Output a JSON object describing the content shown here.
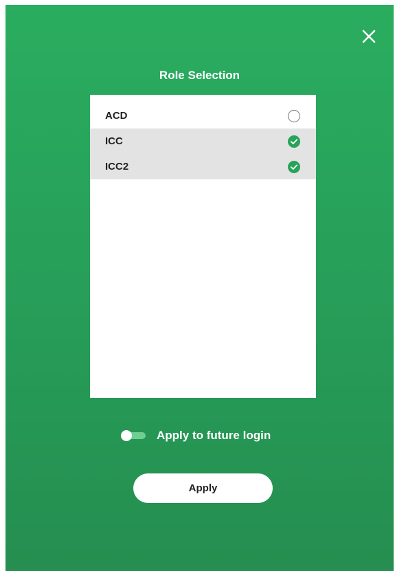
{
  "dialog": {
    "title": "Role Selection",
    "close_icon": "close-icon"
  },
  "roles": [
    {
      "label": "ACD",
      "selected": false,
      "icon": "radio-unchecked-icon"
    },
    {
      "label": "ICC",
      "selected": true,
      "icon": "check-circle-icon"
    },
    {
      "label": "ICC2",
      "selected": true,
      "icon": "check-circle-icon"
    }
  ],
  "future_login": {
    "label": "Apply to future login",
    "enabled": false
  },
  "apply_button": {
    "label": "Apply"
  },
  "colors": {
    "background_top": "#2aad5f",
    "background_bottom": "#258e50",
    "check": "#27a35a",
    "selected_row": "#e3e3e3"
  }
}
